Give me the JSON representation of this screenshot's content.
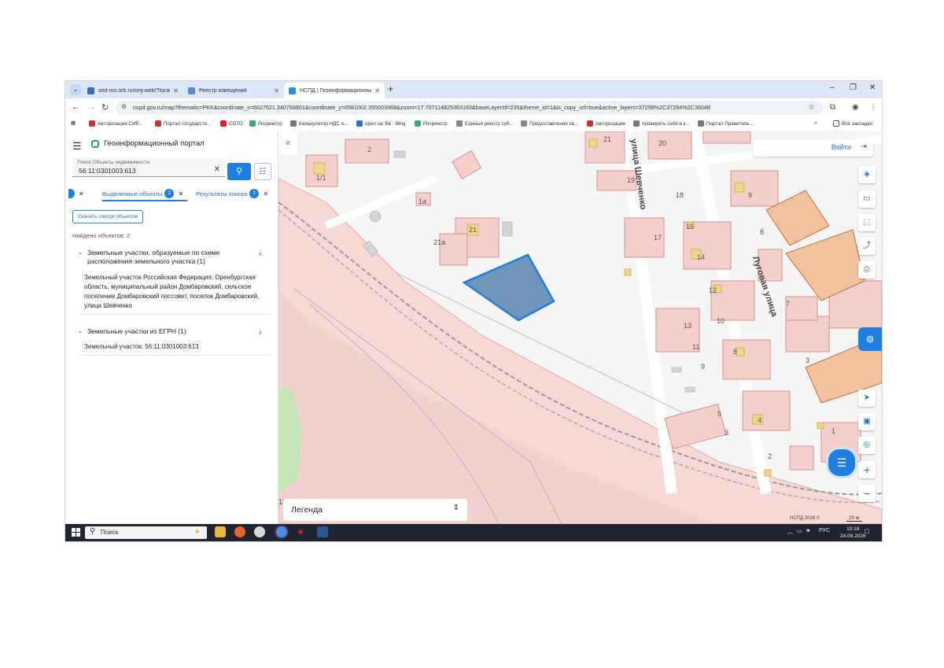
{
  "browser": {
    "tabs": [
      {
        "title": "sed-mo.orb.ru/cmj-web/?locale=",
        "favicon_color": "#3b6ab8"
      },
      {
        "title": "Реестр извещений",
        "favicon_color": "#5a8ad4"
      },
      {
        "title": "НСПД | Геоинформационный п",
        "favicon_color": "#2e8fd6"
      }
    ],
    "new_tab": "+",
    "url": "nspd.gov.ru/map?thematic=PKK&coordinate_x=6627521.340768801&coordinate_y=6581002.355003968&zoom=17.707114825363163&baseLayerId=235&theme_id=1&is_copy_url=true&active_layers=37298%2C37294%2C36048",
    "bookmarks": [
      "Авторизация СИР...",
      "Портал государств...",
      "СОТО",
      "Росреестр",
      "Калькулятор НДС о...",
      "open rar file - Bing",
      "Росреестр",
      "Единый реестр суб...",
      "Предоставление св...",
      "Авторизация",
      "проверить себя и к...",
      "Портал Правитель..."
    ],
    "bookmarks_more": "»",
    "all_bookmarks": "Все закладки"
  },
  "portal": {
    "title": "Геоинформационный портал",
    "search": {
      "label": "Поиск Объекты недвижимости",
      "value": "56:11:0301003:613"
    },
    "tabs": [
      {
        "label": "Выделенные объекты",
        "count": "2"
      },
      {
        "label": "Результаты поиска",
        "count": "1"
      }
    ],
    "download_button": "Скачать список объектов",
    "found": "Найдено объектов: 2",
    "groups": [
      {
        "title": "Земельные участки, образуемые по схеме расположения земельного участка (1)",
        "item": "Земельный участок Российская Федерация, Оренбургская область, муниципальный район Домбаровский, сельское поселение Домбаровский поссовет, поселок Домбаровский, улица Шевченко"
      },
      {
        "title": "Земельные участки из ЕГРН (1)",
        "item": "Земельный участок: 56:11:0301003:613"
      }
    ]
  },
  "map": {
    "login": "Войти",
    "legend": "Легенда",
    "copyright": "НСПД 2026 ©",
    "scale": "20 м",
    "streets": [
      "улица Шевченко",
      "Луговая улица"
    ],
    "labels": [
      "2",
      "1/1",
      "1а",
      "21",
      "21а",
      "21",
      "20",
      "19",
      "18",
      "17",
      "16",
      "14",
      "12",
      "10",
      "13",
      "11",
      "9",
      "9",
      "8",
      "8",
      "7",
      "3",
      "5",
      "3",
      "4",
      "2",
      "1",
      "13"
    ],
    "highlight_color": "#6f95b8"
  },
  "taskbar": {
    "search": "Поиск",
    "lang": "РУС",
    "time": "10:18",
    "date": "24.08.2026"
  }
}
